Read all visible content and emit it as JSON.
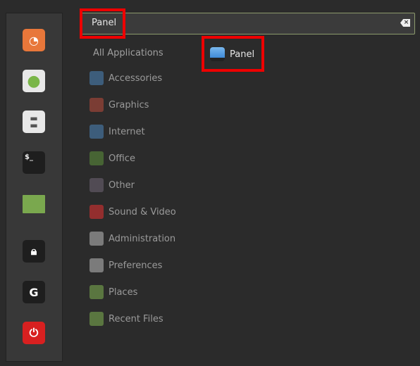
{
  "favorites": [
    {
      "name": "firefox",
      "icon": "firefox-icon",
      "color": "#e8773a"
    },
    {
      "name": "software-manager",
      "icon": "grid-icon",
      "color": "#e8e8e8"
    },
    {
      "name": "settings",
      "icon": "toggles-icon",
      "color": "#e8e8e8"
    },
    {
      "name": "terminal",
      "icon": "terminal-icon",
      "color": "#1e1e1e"
    },
    {
      "name": "files",
      "icon": "folder-icon",
      "color": "#7aa84e"
    },
    {
      "name": "lock",
      "icon": "lock-icon",
      "color": "#1e1e1e"
    },
    {
      "name": "logout",
      "icon": "logout-icon",
      "color": "#1e1e1e"
    },
    {
      "name": "shutdown",
      "icon": "power-icon",
      "color": "#d82020"
    }
  ],
  "search": {
    "value": "Panel"
  },
  "categories": {
    "all": "All Applications",
    "items": [
      {
        "label": "Accessories",
        "color": "#4a7fb0"
      },
      {
        "label": "Graphics",
        "color": "#b04a3a"
      },
      {
        "label": "Internet",
        "color": "#4a7fb0"
      },
      {
        "label": "Office",
        "color": "#5a8a3a"
      },
      {
        "label": "Other",
        "color": "#6a6070"
      },
      {
        "label": "Sound & Video",
        "color": "#d83030"
      },
      {
        "label": "Administration",
        "color": "#b0b0b0"
      },
      {
        "label": "Preferences",
        "color": "#b0b0b0"
      },
      {
        "label": "Places",
        "color": "#7aa84e"
      },
      {
        "label": "Recent Files",
        "color": "#7aa84e"
      }
    ]
  },
  "results": [
    {
      "label": "Panel"
    }
  ],
  "highlight_color": "#e00000"
}
